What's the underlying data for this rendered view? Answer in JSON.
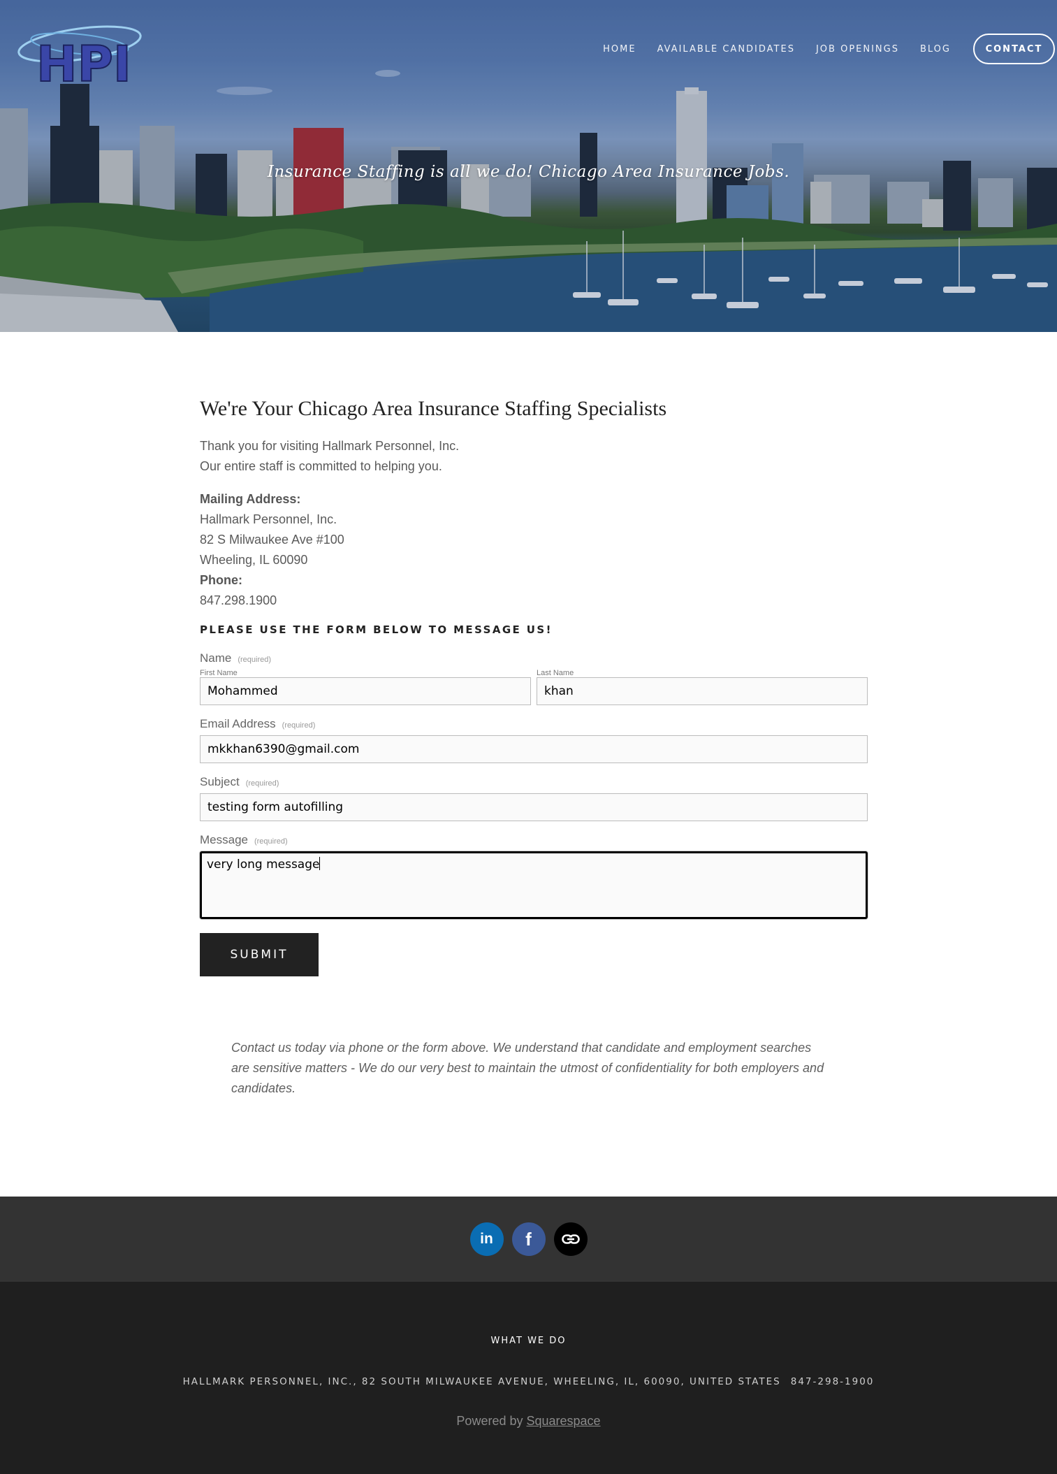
{
  "header": {
    "logo_text": "HPI",
    "tagline": "Insurance Staffing is all we do! Chicago Area Insurance Jobs.",
    "nav": [
      {
        "label": "HOME"
      },
      {
        "label": "AVAILABLE CANDIDATES"
      },
      {
        "label": "JOB OPENINGS"
      },
      {
        "label": "BLOG"
      }
    ],
    "contact_button": "CONTACT"
  },
  "main": {
    "heading": "We're Your Chicago Area Insurance Staffing Specialists",
    "intro_line1": "Thank you for visiting Hallmark Personnel, Inc.",
    "intro_line2": "Our entire staff is committed to helping you.",
    "mailing_label": "Mailing Address:",
    "address_line1": "Hallmark Personnel, Inc.",
    "address_line2": "82 S Milwaukee Ave #100",
    "address_line3": "Wheeling, IL 60090",
    "phone_label": "Phone:",
    "phone": "847.298.1900",
    "form_title": "PLEASE USE THE FORM BELOW TO MESSAGE US!"
  },
  "form": {
    "required_text": "(required)",
    "name_label": "Name",
    "first_name_label": "First Name",
    "first_name_value": "Mohammed",
    "last_name_label": "Last Name",
    "last_name_value": "khan",
    "email_label": "Email Address",
    "email_value": "mkkhan6390@gmail.com",
    "subject_label": "Subject",
    "subject_value": "testing form autofilling",
    "message_label": "Message",
    "message_value": "very long message",
    "submit_label": "SUBMIT"
  },
  "note": "Contact us today via phone or the form above. We understand that candidate and employment searches are sensitive matters - We do our very best to maintain the utmost of confidentiality for both employers and candidates.",
  "social": {
    "icons": [
      "linkedin-icon",
      "facebook-icon",
      "link-icon"
    ],
    "colors": {
      "linkedin": "#0a6db3",
      "facebook": "#3b5998",
      "link": "#000000"
    }
  },
  "footer": {
    "title": "WHAT WE DO",
    "address": "HALLMARK PERSONNEL, INC., 82 SOUTH MILWAUKEE AVENUE, WHEELING, IL, 60090, UNITED STATES",
    "phone": "847-298-1900",
    "powered_prefix": "Powered by ",
    "powered_link": "Squarespace"
  }
}
